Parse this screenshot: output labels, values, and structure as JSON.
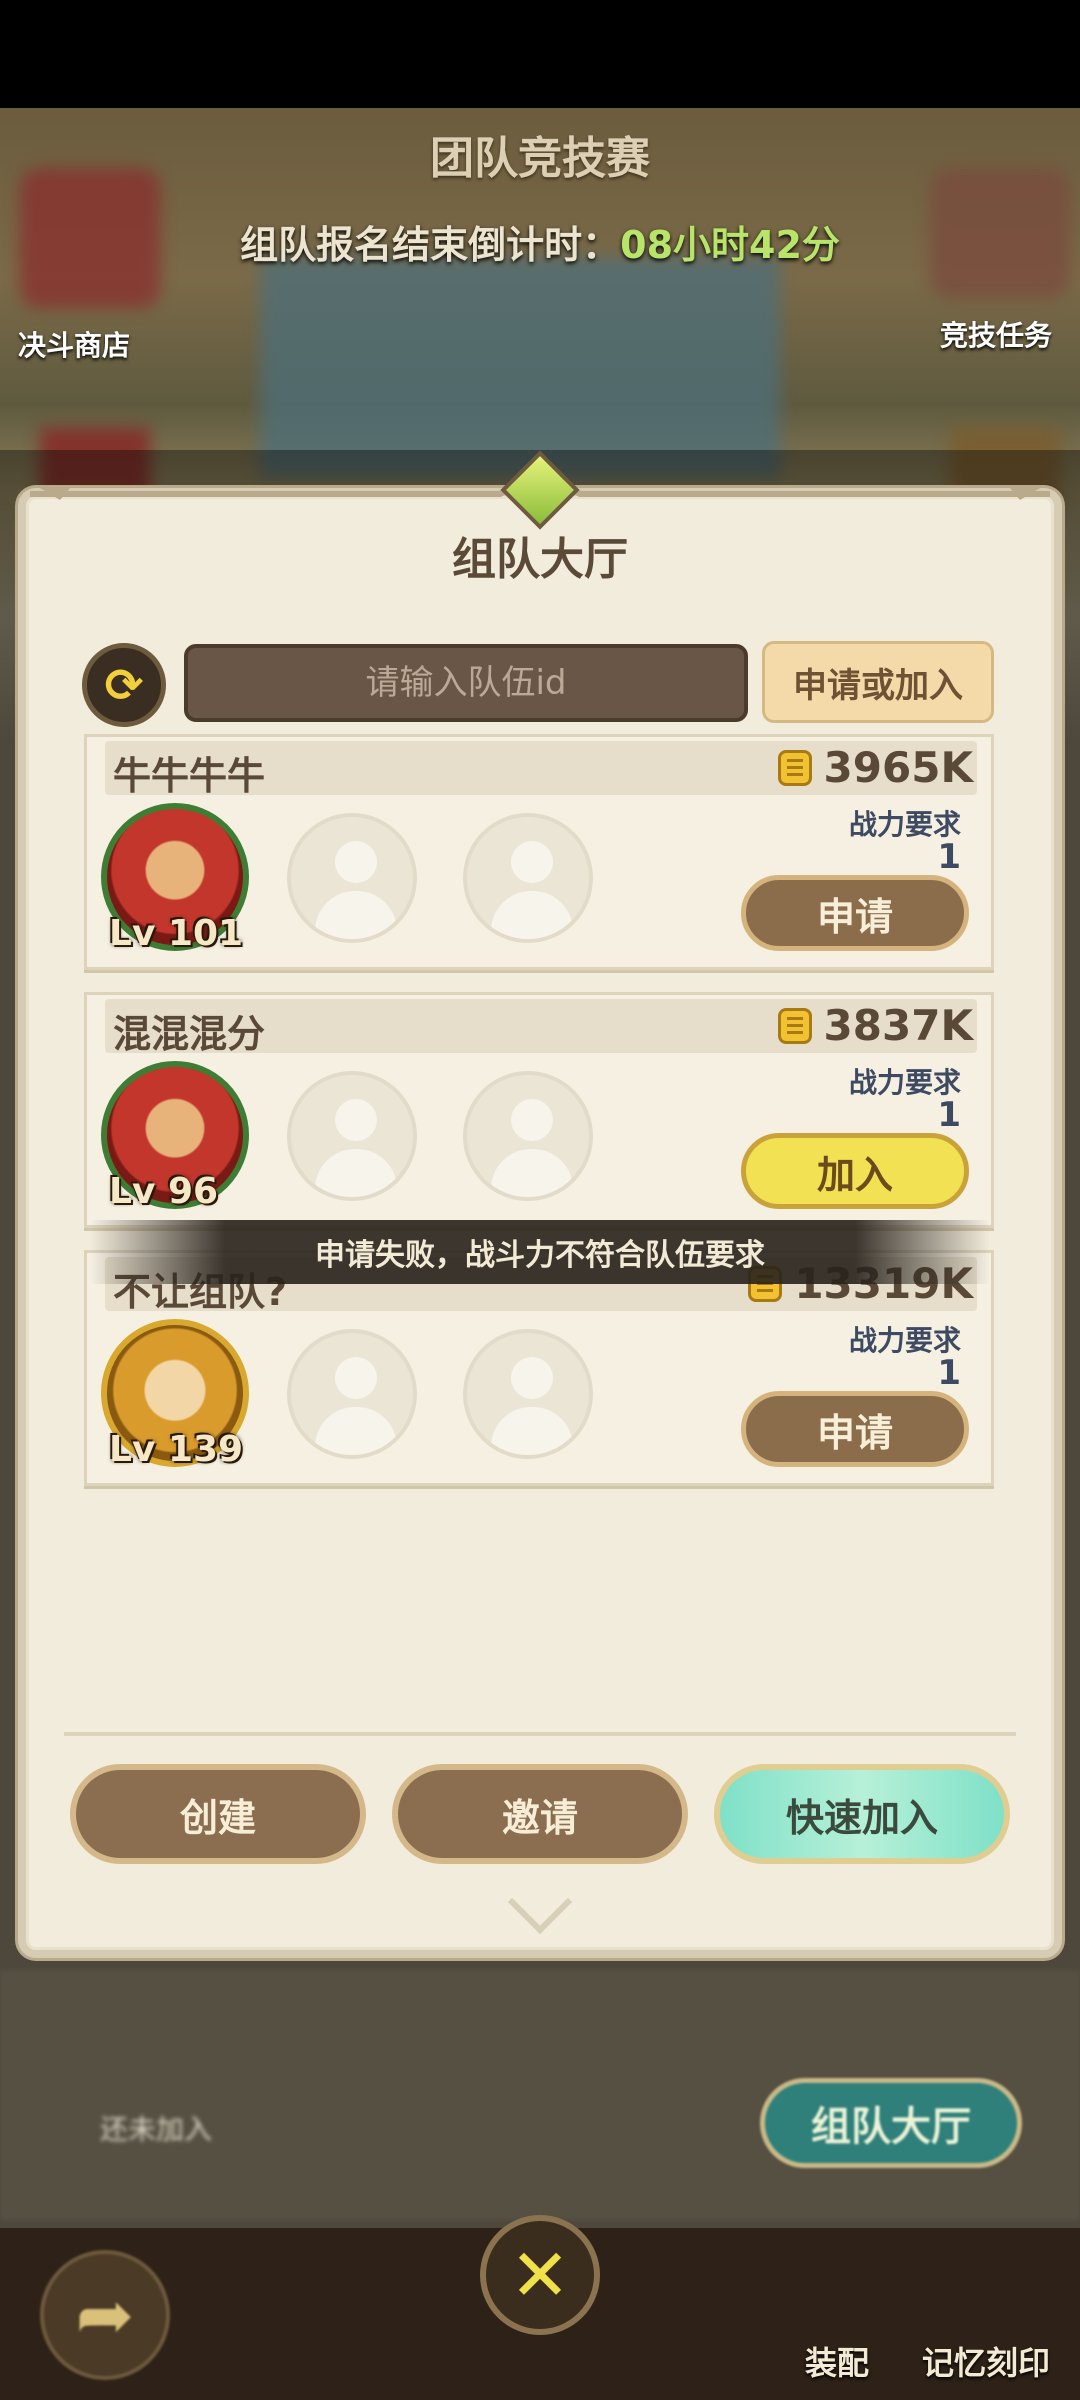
{
  "scene": {
    "title": "团队竞技赛",
    "countdown_label": "组队报名结束倒计时：",
    "countdown_value": "08小时42分",
    "left_shop": "决斗商店",
    "right_task": "竞技任务"
  },
  "panel": {
    "title": "组队大厅",
    "search": {
      "placeholder": "请输入队伍id",
      "value": ""
    },
    "apply_join_label": "申请或加入"
  },
  "teams": [
    {
      "name": "牛牛牛牛",
      "power": "3965K",
      "req_label": "战力要求",
      "req_value": "1",
      "level": "Lv 101",
      "action": "申请",
      "avatar": "red"
    },
    {
      "name": "混混混分",
      "power": "3837K",
      "req_label": "战力要求",
      "req_value": "1",
      "level": "Lv 96",
      "action": "加入",
      "avatar": "red"
    },
    {
      "name": "不让组队?",
      "power": "13319K",
      "req_label": "战力要求",
      "req_value": "1",
      "level": "Lv 139",
      "action": "申请",
      "avatar": "gold"
    }
  ],
  "toast": "申请失败，战斗力不符合队伍要求",
  "buttons": {
    "create": "创建",
    "invite": "邀请",
    "quick_join": "快速加入"
  },
  "lower": {
    "hall_button": "组队大厅",
    "not_joined": "还未加入"
  },
  "bottom_bar": {
    "equip": "装配",
    "memory": "记忆刻印"
  },
  "colors": {
    "accent_green": "#b8e46a",
    "panel_bg": "#f2ecdc",
    "brown": "#8a6e4f"
  }
}
